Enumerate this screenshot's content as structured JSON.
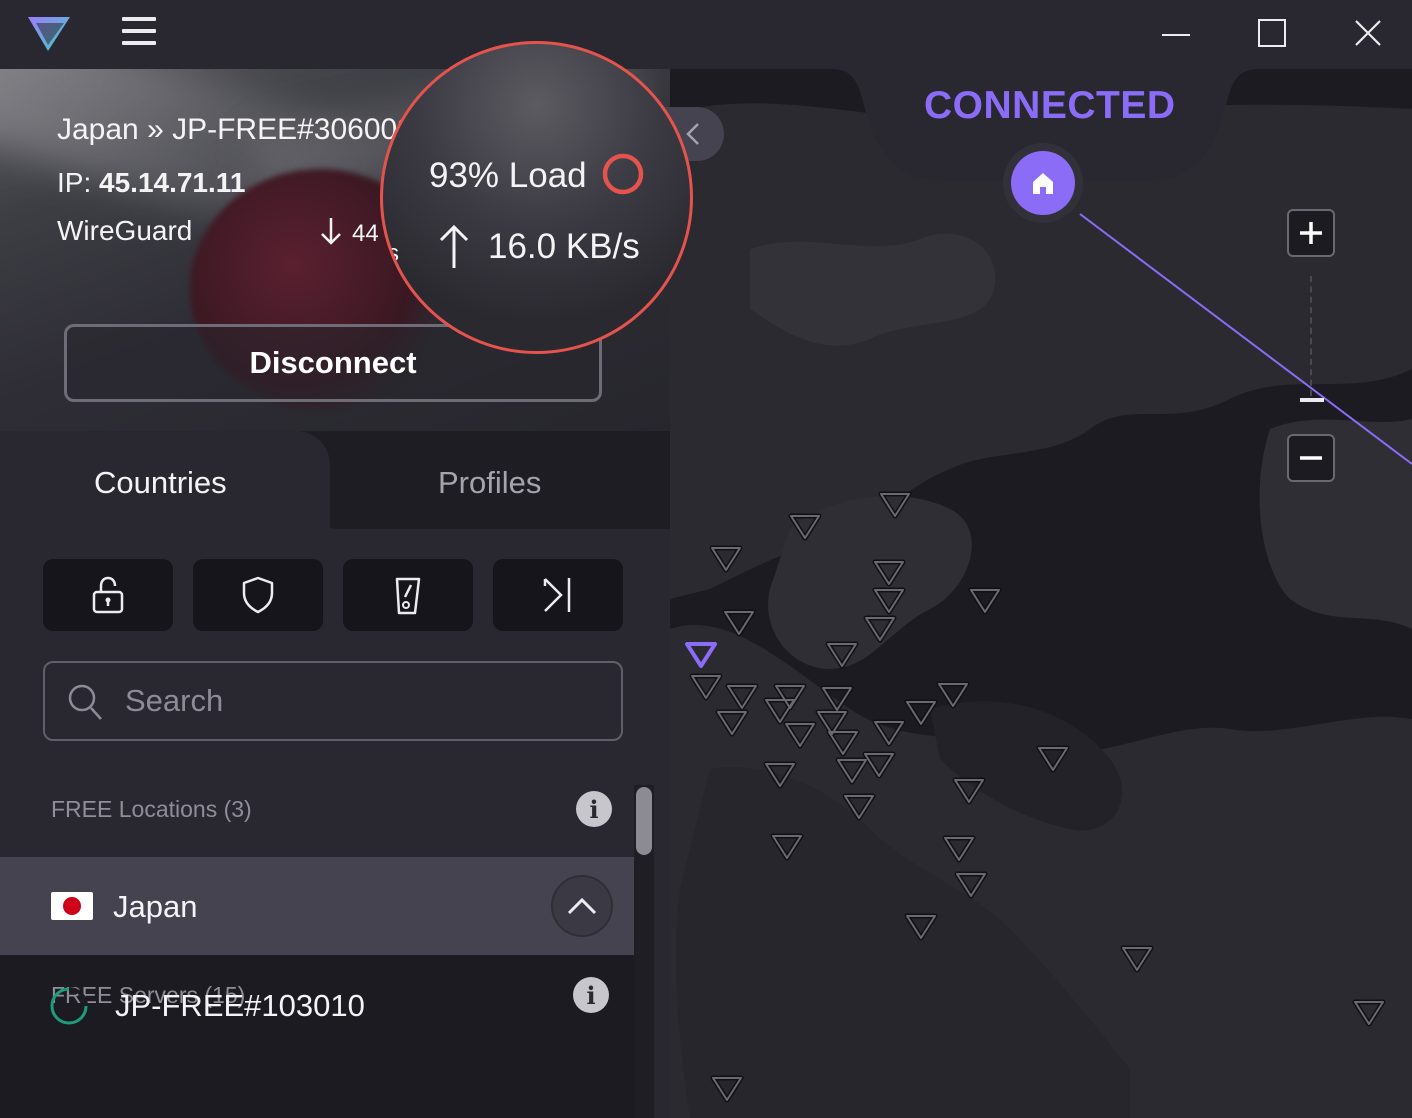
{
  "titlebar": {
    "logo_icon": "protonvpn-logo-icon",
    "menu_icon": "hamburger-menu-icon",
    "window_controls": [
      "minimize-icon",
      "maximize-icon",
      "close-icon"
    ]
  },
  "connection": {
    "server_path": "Japan » JP-FREE#306003",
    "ip_label": "IP:",
    "ip_value": "45.14.71.11",
    "protocol": "WireGuard",
    "download_speed": "44",
    "load_text": "93% Load",
    "load_percent": 93,
    "upload_speed": "16.0 KB/s",
    "disconnect_label": "Disconnect"
  },
  "tabs": {
    "countries": "Countries",
    "profiles": "Profiles",
    "active": "countries"
  },
  "filters": [
    {
      "icon": "lock-icon"
    },
    {
      "icon": "shield-icon"
    },
    {
      "icon": "p2p-icon"
    },
    {
      "icon": "tor-arrow-icon"
    }
  ],
  "search": {
    "placeholder": "Search",
    "value": ""
  },
  "list": {
    "free_locations_label": "FREE Locations (3)",
    "country": "Japan",
    "free_servers_label": "FREE Servers (15)",
    "server": "JP-FREE#103010"
  },
  "map": {
    "status": "CONNECTED",
    "accent_color": "#8b6cf7",
    "zoom_in_icon": "plus-icon",
    "zoom_out_icon": "minus-icon",
    "home_icon": "home-icon"
  },
  "colors": {
    "accent": "#8b6cf7",
    "highlight_ring": "#e4544d",
    "load_red": "#e4544d",
    "load_green": "#1c9c7b"
  }
}
